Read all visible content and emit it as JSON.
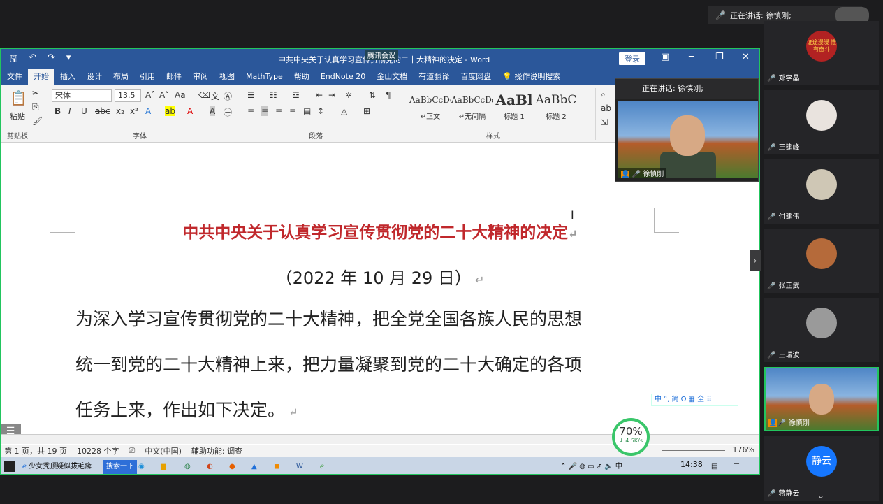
{
  "meeting": {
    "speaking_label": "正在讲话: 徐慎刚;",
    "app_label": "腾讯会议"
  },
  "word": {
    "window_title": "中共中央关于认真学习宣传贯彻党的二十大精神的决定 - Word",
    "login_btn": "登录",
    "tabs": [
      "文件",
      "开始",
      "插入",
      "设计",
      "布局",
      "引用",
      "邮件",
      "审阅",
      "视图",
      "MathType",
      "帮助",
      "EndNote 20",
      "金山文档",
      "有道翻译",
      "百度网盘",
      "操作说明搜索"
    ],
    "ribbon": {
      "paste": "粘贴",
      "clipboard": "剪贴板",
      "font_name": "宋体",
      "font_size": "13.5",
      "font_group": "字体",
      "paragraph_group": "段落",
      "styles_group": "样式",
      "styles": [
        {
          "sample": "AaBbCcDc",
          "name": "↵正文"
        },
        {
          "sample": "AaBbCcDc",
          "name": "↵无间隔"
        },
        {
          "sample": "AaBl",
          "name": "标题 1"
        },
        {
          "sample": "AaBbC",
          "name": "标题 2"
        }
      ]
    },
    "document": {
      "title": "中共中央关于认真学习宣传贯彻党的二十大精神的决定",
      "date": "（2022 年 10 月 29 日）",
      "paragraph_lines": [
        "为深入学习宣传贯彻党的二十大精神，把全党全国各族人民的思想",
        "统一到党的二十大精神上来，把力量凝聚到党的二十大确定的各项",
        "任务上来，作出如下决定。"
      ]
    },
    "status": {
      "page": "第 1 页，共 19 页",
      "words": "10228 个字",
      "lang": "中文(中国)",
      "accessibility": "辅助功能: 调查",
      "zoom": "176%"
    },
    "ime": "中 °, 简 Ω ▦ 全 ⠿"
  },
  "taskbar": {
    "app1": "少女秃顶疑似拔毛癖",
    "search": "搜索一下",
    "clock": "14:38"
  },
  "net": {
    "percent": "70%",
    "speed": "↓ 4.5K/s"
  },
  "floating_video": {
    "speaking_label": "正在讲话: 徐慎刚;",
    "name": "徐慎刚"
  },
  "participants": [
    {
      "name": "郑学晶",
      "avatar": "证途漫漫 惟有奋斗",
      "avatar_color": "#b22222"
    },
    {
      "name": "王建峰",
      "avatar": "",
      "avatar_color": "#e9e3de"
    },
    {
      "name": "付建伟",
      "avatar": "",
      "avatar_color": "#cfc7b5"
    },
    {
      "name": "张正武",
      "avatar": "",
      "avatar_color": "#b56a3a"
    },
    {
      "name": "王瑞波",
      "avatar": "",
      "avatar_color": "#9a9a9a"
    },
    {
      "name": "徐慎刚",
      "avatar": "",
      "avatar_color": "#5c87c2"
    },
    {
      "name": "蒋静云",
      "avatar": "静云",
      "avatar_color": "#1677ff"
    }
  ]
}
